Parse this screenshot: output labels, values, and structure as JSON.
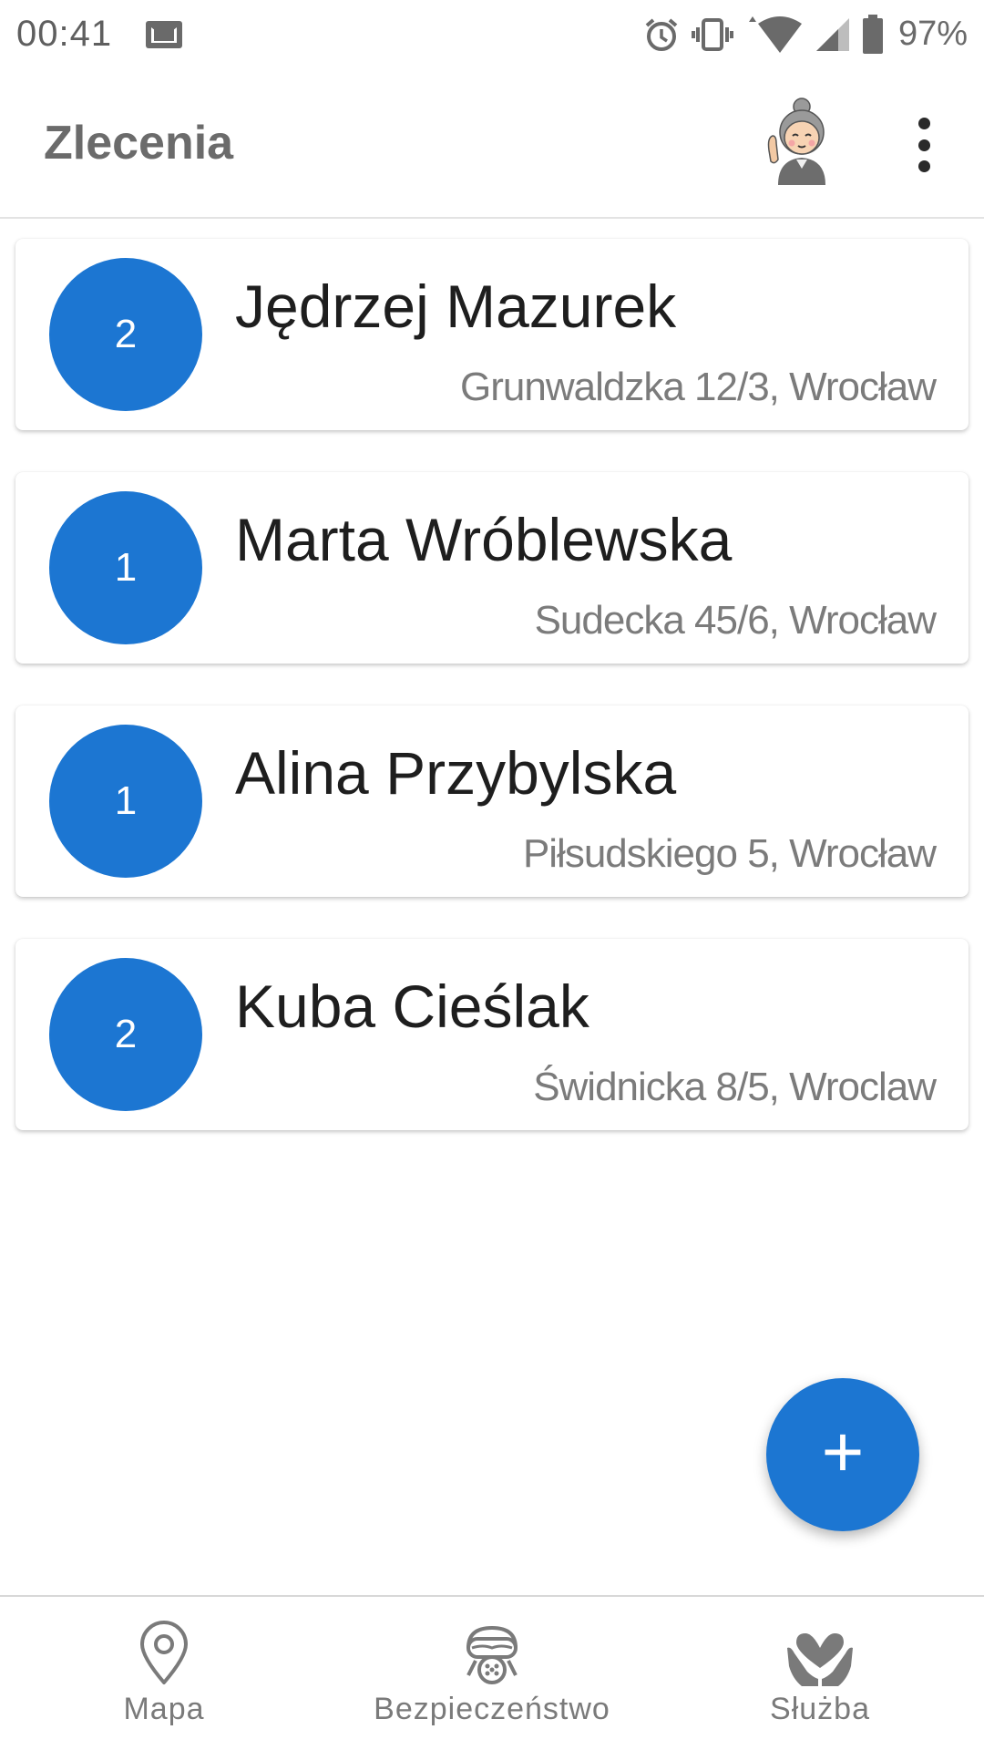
{
  "status_bar": {
    "time": "00:41",
    "battery": "97%",
    "icons": [
      "mail-icon",
      "alarm-icon",
      "vibrate-icon",
      "wifi-icon",
      "signal-icon",
      "battery-icon"
    ]
  },
  "app_bar": {
    "title": "Zlecenia",
    "avatar_icon": "avatar-icon",
    "menu_icon": "more-vert-icon"
  },
  "orders": [
    {
      "count": "2",
      "name": "Jędrzej Mazurek",
      "address": "Grunwaldzka 12/3, Wrocław"
    },
    {
      "count": "1",
      "name": "Marta Wróblewska",
      "address": "Sudecka 45/6, Wrocław"
    },
    {
      "count": "1",
      "name": "Alina Przybylska",
      "address": "Piłsudskiego 5, Wrocław"
    },
    {
      "count": "2",
      "name": "Kuba Cieślak",
      "address": "Świdnicka 8/5, Wroclaw"
    }
  ],
  "fab": {
    "label": "+"
  },
  "bottom_nav": {
    "items": [
      {
        "label": "Mapa",
        "icon": "map-pin-icon"
      },
      {
        "label": "Bezpieczeństwo",
        "icon": "gas-mask-icon"
      },
      {
        "label": "Służba",
        "icon": "heart-hands-icon"
      }
    ]
  },
  "colors": {
    "accent": "#1c76d2",
    "title_text": "#6b6b6b",
    "secondary_text": "#7b7b7b"
  }
}
